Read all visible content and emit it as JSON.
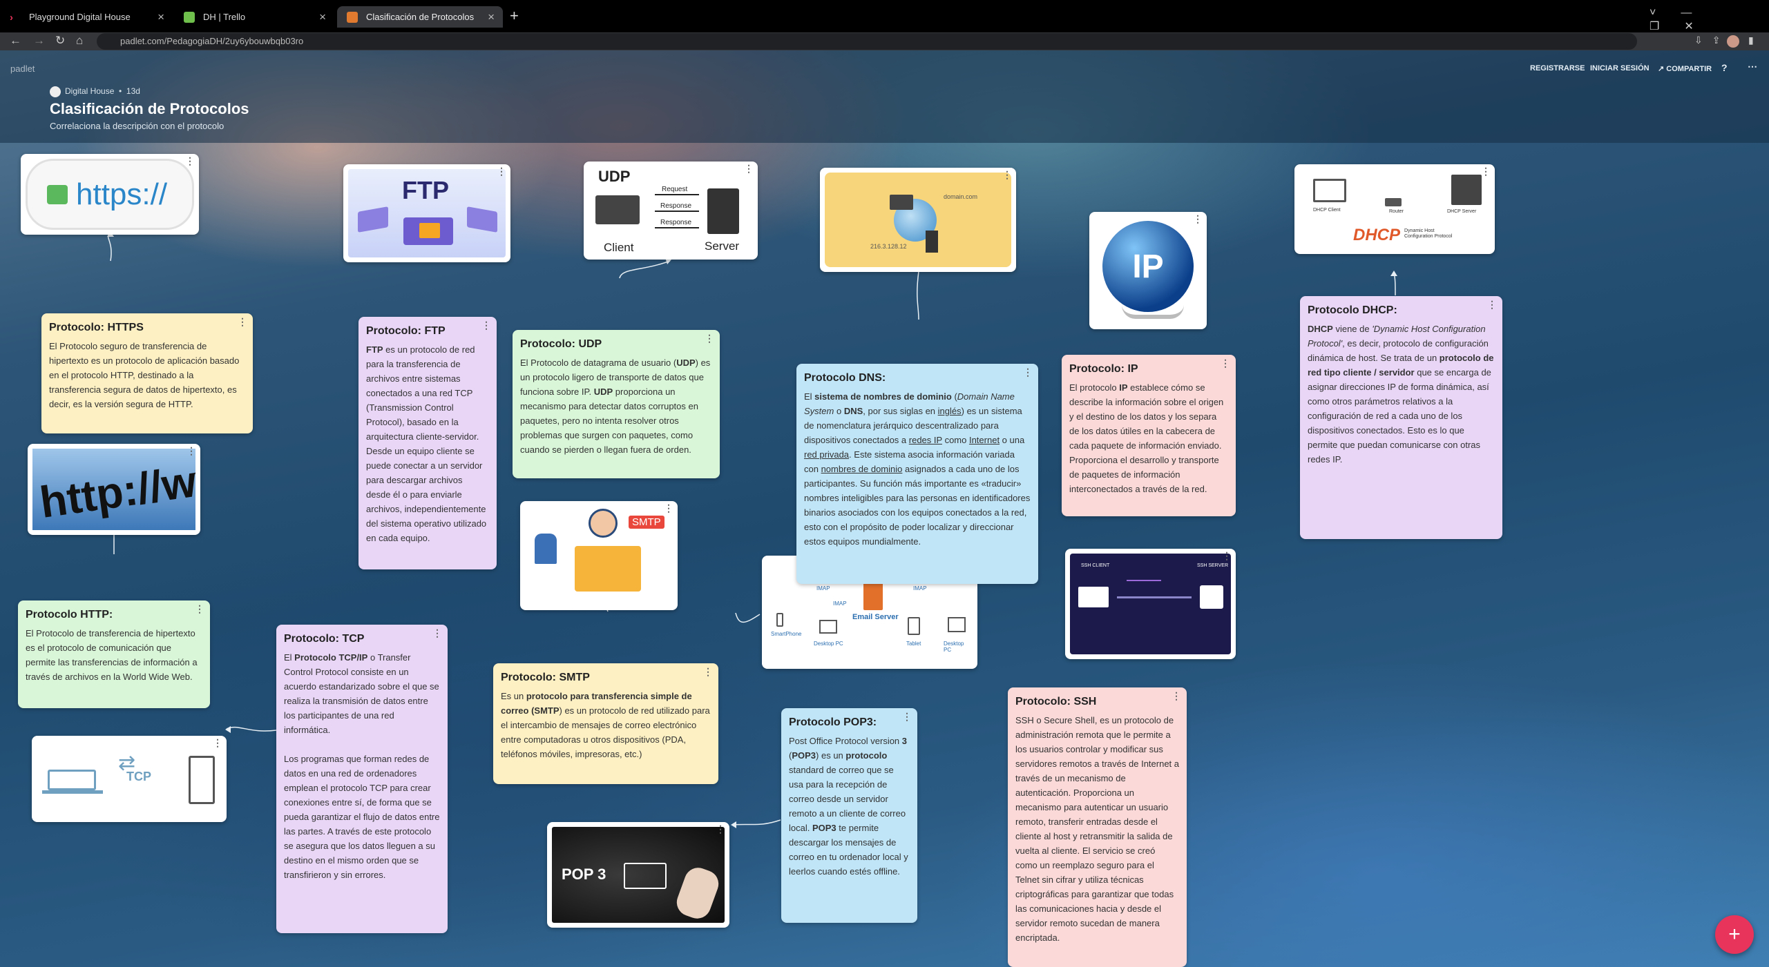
{
  "browser": {
    "tabs": [
      {
        "label": "Playground Digital House"
      },
      {
        "label": "DH | Trello"
      },
      {
        "label": "Clasificación de Protocolos"
      }
    ],
    "url": "padlet.com/PedagogiaDH/2uy6ybouwbqb03ro"
  },
  "header": {
    "logo": "padlet",
    "author": "Digital House",
    "age": "13d",
    "title": "Clasificación de Protocolos",
    "subtitle": "Correlaciona la descripción con el protocolo",
    "register": "REGISTRARSE",
    "login": "INICIAR SESIÓN",
    "share": "COMPARTIR"
  },
  "images": {
    "https": "https://",
    "http": "http://ww",
    "ftp": "FTP",
    "udp_title": "UDP",
    "udp_client": "Client",
    "udp_server": "Server",
    "udp_request": "Request",
    "udp_response": "Response",
    "udp_response2": "Response",
    "dns_domain": "domain.com",
    "dns_ip": "216.3.128.12",
    "ip": "IP",
    "dhcp": "DHCP",
    "dhcp_client": "DHCP Client",
    "dhcp_router": "Router",
    "dhcp_server": "DHCP Server",
    "dhcp_caption": "Dynamic Host Configuration Protocol",
    "smtp": "SMTP",
    "tcp": "TCP",
    "email_server": "Email Server",
    "imap1": "IMAP",
    "imap2": "IMAP",
    "imap3": "IMAP",
    "smartphone": "SmartPhone",
    "desktop1": "Desktop PC",
    "tablet": "Tablet",
    "desktop2": "Desktop PC",
    "ssh_client": "SSH CLIENT",
    "ssh_server": "SSH SERVER",
    "pop3": "POP 3"
  },
  "cards": {
    "https": {
      "title": "Protocolo: HTTPS",
      "body": "El Protocolo seguro de transferencia de hipertexto es un protocolo de aplicación basado en el protocolo HTTP, destinado a la transferencia segura de datos de hipertexto, es decir, es la versión segura de HTTP."
    },
    "http": {
      "title": "Protocolo HTTP:",
      "body": "El Protocolo de transferencia de hipertexto es el protocolo de comunicación que permite las transferencias de información a través de archivos en la World Wide Web."
    },
    "ftp": {
      "title": "Protocolo: FTP",
      "t1": "FTP",
      "t2": "  es un protocolo de red para la transferencia de archivos entre sistemas conectados a una red TCP (Transmission Control Protocol), basado en la arquitectura cliente-servidor. Desde un equipo cliente se puede conectar a un servidor para descargar archivos desde él o para enviarle archivos, independientemente del sistema operativo utilizado en cada equipo."
    },
    "tcp": {
      "title": "Protocolo: TCP",
      "t1": "El ",
      "t2": "Protocolo TCP/IP",
      "t3": " o Transfer Control Protocol consiste en un acuerdo estandarizado sobre el que se realiza la transmisión de datos entre los participantes de una red informática.",
      "t4": "Los programas que forman redes de datos en una red de ordenadores emplean el protocolo TCP para crear conexiones entre sí, de forma que se pueda garantizar el flujo de datos entre las partes. A través de este protocolo se asegura que los datos lleguen a su destino en el mismo orden que se transfirieron y sin errores."
    },
    "udp": {
      "title": "Protocolo: UDP",
      "t1": "El Protocolo de datagrama de usuario (",
      "t2": "UDP",
      "t3": ") es un protocolo ligero de transporte de datos que funciona sobre IP. ",
      "t4": "UDP",
      "t5": " proporciona un mecanismo para detectar datos corruptos en paquetes, pero no intenta resolver otros problemas que surgen con paquetes, como cuando se pierden o llegan fuera de orden."
    },
    "smtp": {
      "title": "Protocolo: SMTP",
      "t1": "Es un ",
      "t2": "protocolo para transferencia simple de correo (SMTP",
      "t3": ") es un protocolo de red utilizado para el intercambio de mensajes de correo electrónico entre computadoras u otros dispositivos (PDA, teléfonos móviles, impresoras, etc.)"
    },
    "pop3": {
      "title": "Protocolo POP3:",
      "t1": "Post Office Protocol version ",
      "t2": "3",
      "t3": " (",
      "t4": "POP3",
      "t5": ") es un ",
      "t6": "protocolo",
      "t7": " standard de correo que se usa para la recepción de correo desde un servidor remoto a un cliente de correo local. ",
      "t8": "POP3",
      "t9": " te permite descargar los mensajes de correo en tu ordenador local y leerlos cuando estés offline."
    },
    "dns": {
      "title": "Protocolo DNS:",
      "t1": "El ",
      "t2": "sistema de nombres de dominio",
      "t3": " (",
      "t4": "Domain Name System",
      "t5": " o ",
      "t6": "DNS",
      "t7": ", por sus siglas en ",
      "t8": "inglés",
      "t9": ") es un sistema de nomenclatura jerárquico descentralizado para dispositivos conectados a ",
      "t10": "redes IP",
      "t11": " como ",
      "t12": "Internet",
      "t13": " o una ",
      "t14": "red privada",
      "t15": ". Este sistema asocia información variada con ",
      "t16": "nombres de dominio",
      "t17": " asignados a cada uno de los participantes. Su función más importante es «traducir» nombres inteligibles para las personas en identificadores binarios asociados con los equipos conectados a la red, esto con el propósito de poder localizar y direccionar estos equipos mundialmente."
    },
    "ip": {
      "title": "Protocolo: IP",
      "t1": "El protocolo ",
      "t2": "IP",
      "t3": " establece cómo se describe la información sobre el origen y el destino de los datos y los separa de los datos útiles en la cabecera de cada paquete de información enviado. Proporciona el desarrollo y transporte de paquetes de información interconectados a través de la red."
    },
    "ssh": {
      "title": "Protocolo: SSH",
      "body": "SSH o Secure Shell, es un protocolo de administración remota que le permite a los usuarios controlar y modificar sus servidores remotos a través de Internet a través de un mecanismo de autenticación. Proporciona un mecanismo para autenticar un usuario remoto, transferir entradas desde el cliente al host y retransmitir la salida de vuelta al cliente. El servicio se creó como un reemplazo seguro para el Telnet sin cifrar y utiliza técnicas criptográficas para garantizar que todas las comunicaciones hacia y desde el servidor remoto sucedan de manera encriptada."
    },
    "dhcp": {
      "title": "Protocolo DHCP:",
      "t1": "DHCP",
      "t2": " viene de ",
      "t3": "'Dynamic Host Configuration Protocol'",
      "t4": ", es decir, protocolo de configuración dinámica de host. Se trata de un ",
      "t5": "protocolo de red tipo cliente / servidor",
      "t6": " que se encarga de asignar direcciones IP de forma dinámica, así como otros parámetros relativos a la configuración de red a cada uno de los dispositivos conectados. Esto es lo que permite que puedan comunicarse con otras redes IP."
    }
  },
  "fab": "+"
}
